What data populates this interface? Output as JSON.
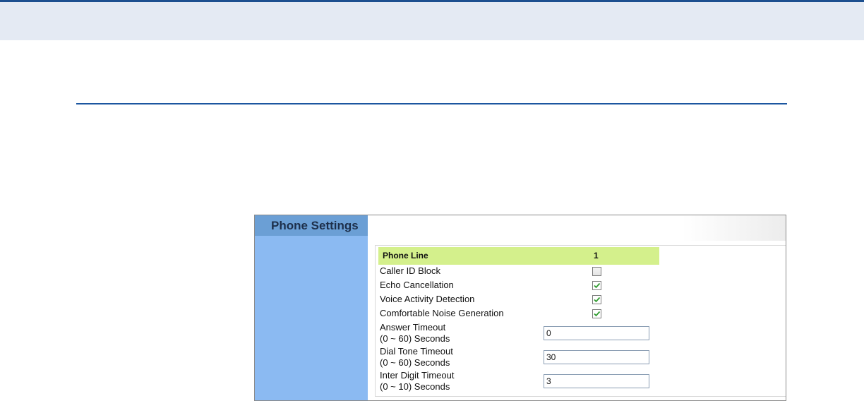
{
  "window": {
    "sidebar_title": "Phone Settings"
  },
  "table": {
    "header": {
      "label": "Phone Line",
      "value": "1"
    },
    "checkbox_rows": [
      {
        "label": "Caller ID Block",
        "checked": false
      },
      {
        "label": "Echo Cancellation",
        "checked": true
      },
      {
        "label": "Voice Activity Detection",
        "checked": true
      },
      {
        "label": "Comfortable Noise Generation",
        "checked": true
      }
    ],
    "timeout_rows": [
      {
        "label": "Answer Timeout",
        "range": "(0 ~ 60) Seconds",
        "value": "0"
      },
      {
        "label": "Dial Tone Timeout",
        "range": "(0 ~ 60) Seconds",
        "value": "30"
      },
      {
        "label": "Inter Digit Timeout",
        "range": "(0 ~ 10) Seconds",
        "value": "3"
      }
    ]
  },
  "colors": {
    "header_band": "#e4eaf3",
    "rule": "#1c56a0",
    "sidebar": "#8bbaf2",
    "sidebar_title_bg": "#6b9fd5",
    "header_row": "#d4f08c",
    "check": "#2e9a2e"
  },
  "icons": {
    "checkmark": "checkmark-icon"
  }
}
